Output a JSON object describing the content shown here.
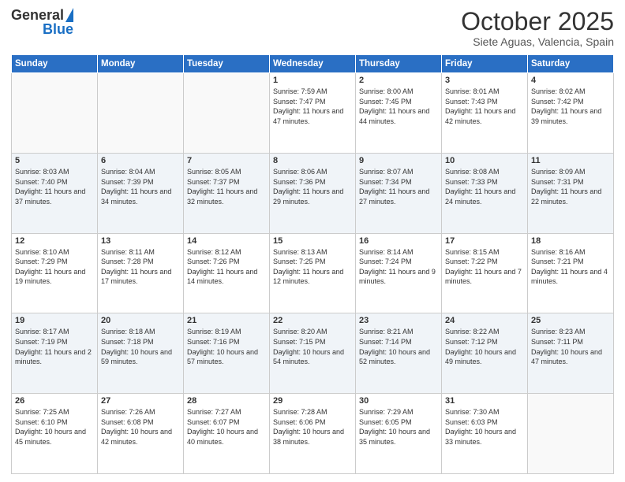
{
  "logo": {
    "general": "General",
    "blue": "Blue"
  },
  "header": {
    "month": "October 2025",
    "location": "Siete Aguas, Valencia, Spain"
  },
  "weekdays": [
    "Sunday",
    "Monday",
    "Tuesday",
    "Wednesday",
    "Thursday",
    "Friday",
    "Saturday"
  ],
  "weeks": [
    [
      {
        "day": "",
        "sunrise": "",
        "sunset": "",
        "daylight": ""
      },
      {
        "day": "",
        "sunrise": "",
        "sunset": "",
        "daylight": ""
      },
      {
        "day": "",
        "sunrise": "",
        "sunset": "",
        "daylight": ""
      },
      {
        "day": "1",
        "sunrise": "Sunrise: 7:59 AM",
        "sunset": "Sunset: 7:47 PM",
        "daylight": "Daylight: 11 hours and 47 minutes."
      },
      {
        "day": "2",
        "sunrise": "Sunrise: 8:00 AM",
        "sunset": "Sunset: 7:45 PM",
        "daylight": "Daylight: 11 hours and 44 minutes."
      },
      {
        "day": "3",
        "sunrise": "Sunrise: 8:01 AM",
        "sunset": "Sunset: 7:43 PM",
        "daylight": "Daylight: 11 hours and 42 minutes."
      },
      {
        "day": "4",
        "sunrise": "Sunrise: 8:02 AM",
        "sunset": "Sunset: 7:42 PM",
        "daylight": "Daylight: 11 hours and 39 minutes."
      }
    ],
    [
      {
        "day": "5",
        "sunrise": "Sunrise: 8:03 AM",
        "sunset": "Sunset: 7:40 PM",
        "daylight": "Daylight: 11 hours and 37 minutes."
      },
      {
        "day": "6",
        "sunrise": "Sunrise: 8:04 AM",
        "sunset": "Sunset: 7:39 PM",
        "daylight": "Daylight: 11 hours and 34 minutes."
      },
      {
        "day": "7",
        "sunrise": "Sunrise: 8:05 AM",
        "sunset": "Sunset: 7:37 PM",
        "daylight": "Daylight: 11 hours and 32 minutes."
      },
      {
        "day": "8",
        "sunrise": "Sunrise: 8:06 AM",
        "sunset": "Sunset: 7:36 PM",
        "daylight": "Daylight: 11 hours and 29 minutes."
      },
      {
        "day": "9",
        "sunrise": "Sunrise: 8:07 AM",
        "sunset": "Sunset: 7:34 PM",
        "daylight": "Daylight: 11 hours and 27 minutes."
      },
      {
        "day": "10",
        "sunrise": "Sunrise: 8:08 AM",
        "sunset": "Sunset: 7:33 PM",
        "daylight": "Daylight: 11 hours and 24 minutes."
      },
      {
        "day": "11",
        "sunrise": "Sunrise: 8:09 AM",
        "sunset": "Sunset: 7:31 PM",
        "daylight": "Daylight: 11 hours and 22 minutes."
      }
    ],
    [
      {
        "day": "12",
        "sunrise": "Sunrise: 8:10 AM",
        "sunset": "Sunset: 7:29 PM",
        "daylight": "Daylight: 11 hours and 19 minutes."
      },
      {
        "day": "13",
        "sunrise": "Sunrise: 8:11 AM",
        "sunset": "Sunset: 7:28 PM",
        "daylight": "Daylight: 11 hours and 17 minutes."
      },
      {
        "day": "14",
        "sunrise": "Sunrise: 8:12 AM",
        "sunset": "Sunset: 7:26 PM",
        "daylight": "Daylight: 11 hours and 14 minutes."
      },
      {
        "day": "15",
        "sunrise": "Sunrise: 8:13 AM",
        "sunset": "Sunset: 7:25 PM",
        "daylight": "Daylight: 11 hours and 12 minutes."
      },
      {
        "day": "16",
        "sunrise": "Sunrise: 8:14 AM",
        "sunset": "Sunset: 7:24 PM",
        "daylight": "Daylight: 11 hours and 9 minutes."
      },
      {
        "day": "17",
        "sunrise": "Sunrise: 8:15 AM",
        "sunset": "Sunset: 7:22 PM",
        "daylight": "Daylight: 11 hours and 7 minutes."
      },
      {
        "day": "18",
        "sunrise": "Sunrise: 8:16 AM",
        "sunset": "Sunset: 7:21 PM",
        "daylight": "Daylight: 11 hours and 4 minutes."
      }
    ],
    [
      {
        "day": "19",
        "sunrise": "Sunrise: 8:17 AM",
        "sunset": "Sunset: 7:19 PM",
        "daylight": "Daylight: 11 hours and 2 minutes."
      },
      {
        "day": "20",
        "sunrise": "Sunrise: 8:18 AM",
        "sunset": "Sunset: 7:18 PM",
        "daylight": "Daylight: 10 hours and 59 minutes."
      },
      {
        "day": "21",
        "sunrise": "Sunrise: 8:19 AM",
        "sunset": "Sunset: 7:16 PM",
        "daylight": "Daylight: 10 hours and 57 minutes."
      },
      {
        "day": "22",
        "sunrise": "Sunrise: 8:20 AM",
        "sunset": "Sunset: 7:15 PM",
        "daylight": "Daylight: 10 hours and 54 minutes."
      },
      {
        "day": "23",
        "sunrise": "Sunrise: 8:21 AM",
        "sunset": "Sunset: 7:14 PM",
        "daylight": "Daylight: 10 hours and 52 minutes."
      },
      {
        "day": "24",
        "sunrise": "Sunrise: 8:22 AM",
        "sunset": "Sunset: 7:12 PM",
        "daylight": "Daylight: 10 hours and 49 minutes."
      },
      {
        "day": "25",
        "sunrise": "Sunrise: 8:23 AM",
        "sunset": "Sunset: 7:11 PM",
        "daylight": "Daylight: 10 hours and 47 minutes."
      }
    ],
    [
      {
        "day": "26",
        "sunrise": "Sunrise: 7:25 AM",
        "sunset": "Sunset: 6:10 PM",
        "daylight": "Daylight: 10 hours and 45 minutes."
      },
      {
        "day": "27",
        "sunrise": "Sunrise: 7:26 AM",
        "sunset": "Sunset: 6:08 PM",
        "daylight": "Daylight: 10 hours and 42 minutes."
      },
      {
        "day": "28",
        "sunrise": "Sunrise: 7:27 AM",
        "sunset": "Sunset: 6:07 PM",
        "daylight": "Daylight: 10 hours and 40 minutes."
      },
      {
        "day": "29",
        "sunrise": "Sunrise: 7:28 AM",
        "sunset": "Sunset: 6:06 PM",
        "daylight": "Daylight: 10 hours and 38 minutes."
      },
      {
        "day": "30",
        "sunrise": "Sunrise: 7:29 AM",
        "sunset": "Sunset: 6:05 PM",
        "daylight": "Daylight: 10 hours and 35 minutes."
      },
      {
        "day": "31",
        "sunrise": "Sunrise: 7:30 AM",
        "sunset": "Sunset: 6:03 PM",
        "daylight": "Daylight: 10 hours and 33 minutes."
      },
      {
        "day": "",
        "sunrise": "",
        "sunset": "",
        "daylight": ""
      }
    ]
  ]
}
